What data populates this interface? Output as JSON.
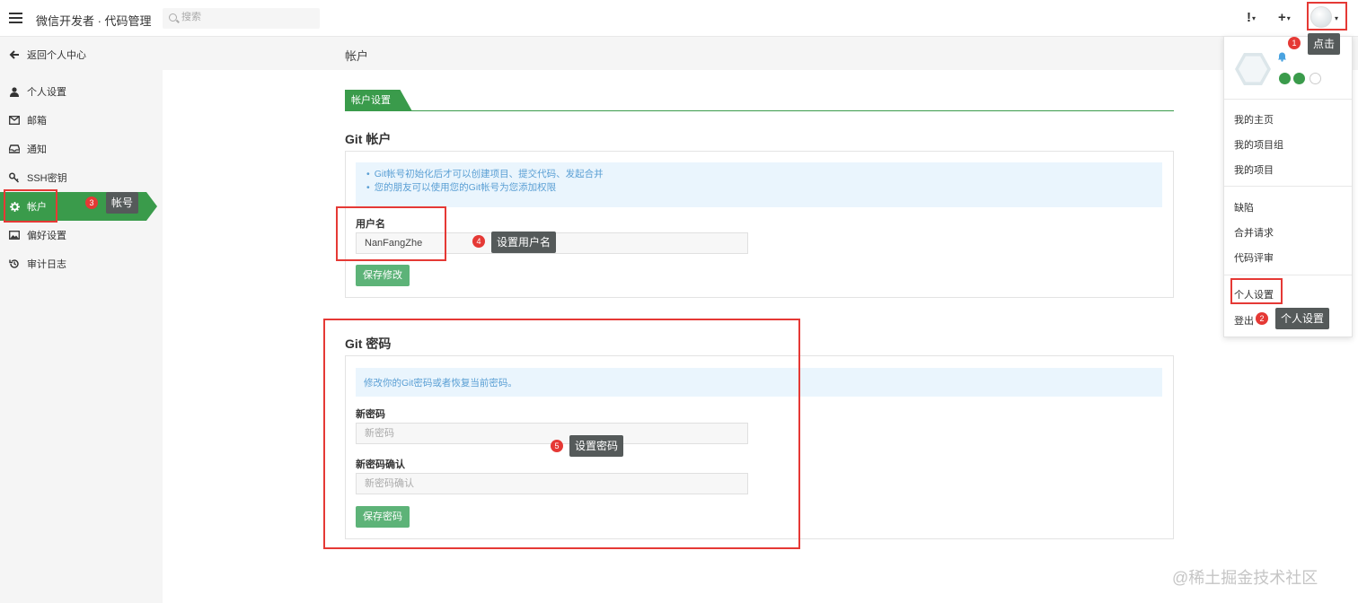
{
  "topbar": {
    "app_title": "微信开发者 · 代码管理",
    "search_placeholder": "搜索",
    "alert_label": "!",
    "add_label": "+"
  },
  "sidebar": {
    "back_label": "返回个人中心",
    "items": [
      {
        "label": "个人设置",
        "icon": "user-icon"
      },
      {
        "label": "邮箱",
        "icon": "mail-icon"
      },
      {
        "label": "通知",
        "icon": "inbox-icon"
      },
      {
        "label": "SSH密钥",
        "icon": "key-icon"
      },
      {
        "label": "帐户",
        "icon": "gear-icon",
        "active": true
      },
      {
        "label": "偏好设置",
        "icon": "image-icon"
      },
      {
        "label": "审计日志",
        "icon": "history-icon"
      }
    ]
  },
  "main": {
    "header_title": "帐户",
    "tab_label": "帐户设置",
    "git_account": {
      "title": "Git 帐户",
      "info": [
        "Git帐号初始化后才可以创建项目、提交代码、发起合并",
        "您的朋友可以使用您的Git帐号为您添加权限"
      ],
      "username_label": "用户名",
      "username_value": "NanFangZhe",
      "save_label": "保存修改"
    },
    "git_password": {
      "title": "Git 密码",
      "info": "修改你的Git密码或者恢复当前密码。",
      "new_password_label": "新密码",
      "new_password_placeholder": "新密码",
      "confirm_label": "新密码确认",
      "confirm_placeholder": "新密码确认",
      "save_label": "保存密码"
    }
  },
  "dropdown": {
    "items_group1": [
      "我的主页",
      "我的项目组",
      "我的项目"
    ],
    "items_group2": [
      "缺陷",
      "合并请求",
      "代码评审"
    ],
    "settings_label": "个人设置",
    "logout_label": "登出"
  },
  "annotations": [
    {
      "num": "1",
      "text": "点击"
    },
    {
      "num": "2",
      "text": "个人设置"
    },
    {
      "num": "3",
      "text": "帐号"
    },
    {
      "num": "4",
      "text": "设置用户名"
    },
    {
      "num": "5",
      "text": "设置密码"
    }
  ],
  "watermark": "@稀土掘金技术社区",
  "colors": {
    "accent": "#3a9b4b",
    "button": "#5db378",
    "annotation": "#e53935",
    "info_bg": "#eaf5fd"
  }
}
